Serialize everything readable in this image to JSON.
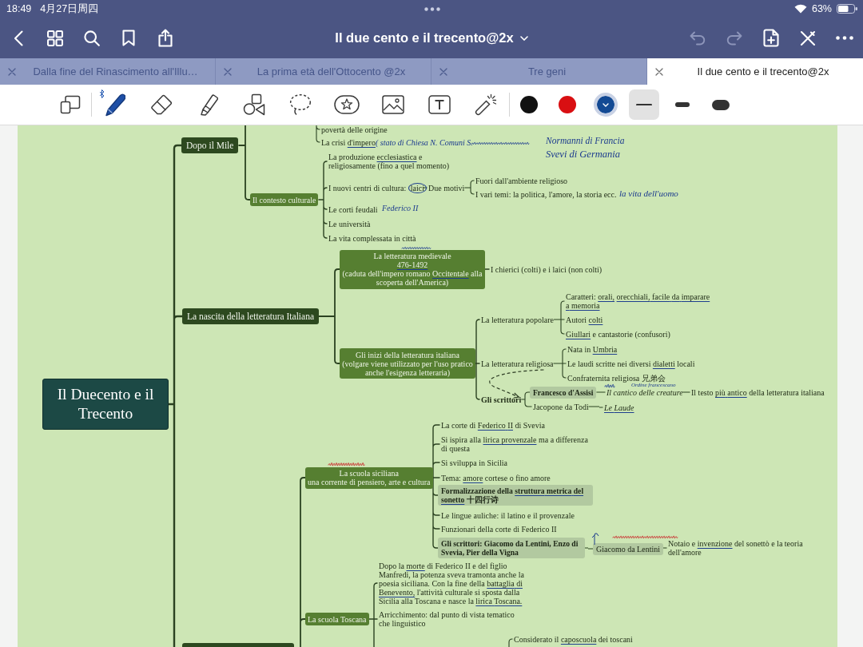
{
  "status_bar": {
    "time": "18:49",
    "date": "4月27日周四",
    "battery": "63%"
  },
  "nav_bar": {
    "title": "Il due cento e il trecento@2x",
    "undo": {
      "disabled": true
    },
    "redo": {
      "disabled": true
    }
  },
  "tabs": [
    {
      "label": "Dalla fine del Rinascimento all'Illu…",
      "selected": false
    },
    {
      "label": "La prima età dell'Ottocento @2x",
      "selected": false
    },
    {
      "label": "Tre geni",
      "selected": false
    },
    {
      "label": "Il due cento e il trecento@2x",
      "selected": true
    }
  ],
  "toolbar": {
    "tools": [
      {
        "kind": "reader",
        "selected": false
      },
      {
        "kind": "pen",
        "selected": true
      },
      {
        "kind": "eraser",
        "selected": false
      },
      {
        "kind": "highlighter",
        "selected": false
      },
      {
        "kind": "shapes",
        "selected": false
      },
      {
        "kind": "lasso",
        "selected": false
      },
      {
        "kind": "sticker",
        "selected": false
      },
      {
        "kind": "image",
        "selected": false
      },
      {
        "kind": "textbox",
        "selected": false
      },
      {
        "kind": "laser",
        "selected": false
      }
    ],
    "colors": [
      {
        "color": "#111111",
        "selected": false
      },
      {
        "color": "#d90f12",
        "selected": false
      },
      {
        "color": "#134a94",
        "selected": true
      }
    ],
    "widths": [
      {
        "kind": "thin",
        "selected": true
      },
      {
        "kind": "medium",
        "selected": false
      },
      {
        "kind": "thick",
        "selected": false
      }
    ]
  },
  "mind_map": {
    "root": {
      "text": "Il Duecento e il Trecento",
      "kind": "root",
      "children": [
        {
          "text": "Dopo il Mile",
          "kind": "main",
          "children": [
            {
              "kind": "offscreen",
              "children": [
                {
                  "text": "povertà delle origine",
                  "kind": "leaf"
                },
                {
                  "text": "La crisi d'impero",
                  "kind": "leaf"
                }
              ]
            },
            {
              "text": "Il contesto culturale",
              "kind": "sub",
              "children": [
                {
                  "text": "La produzione ecclesiastica e religiosamente (fino a quel momento)",
                  "kind": "leaf"
                },
                {
                  "text": "I nuovi centri di cultura: laici",
                  "kind": "leaf",
                  "children": [
                    {
                      "text": "Due motivi",
                      "kind": "leaf",
                      "children": [
                        {
                          "text": "Fuori dall'ambiente religioso",
                          "kind": "leaf"
                        },
                        {
                          "text": "I vari temi: la politica, l'amore, la storia ecc.",
                          "kind": "leaf"
                        }
                      ]
                    }
                  ]
                },
                {
                  "text": "Le corti feudali",
                  "kind": "leaf"
                },
                {
                  "text": "Le università",
                  "kind": "leaf"
                },
                {
                  "text": "La vita complessata in città",
                  "kind": "leaf"
                }
              ]
            }
          ]
        },
        {
          "text": "La nascita della letteratura Italiana",
          "kind": "main",
          "children": [
            {
              "text": "La letteratura medievale\n476-1492\n(caduta dell'impero romano Occitentale alla scoperta dell'America)",
              "kind": "sub",
              "children": [
                {
                  "text": "I chierici (colti) e i laici (non colti)",
                  "kind": "leaf"
                }
              ]
            },
            {
              "text": "Gli inizi della letteratura italiana\n(volgare viene utilizzato per l'uso pratico anche l'esigenza letteraria)",
              "kind": "sub",
              "children": [
                {
                  "text": "La letteratura popolare",
                  "kind": "leaf",
                  "children": [
                    {
                      "text": "Caratteri: orali, orecchiali, facile da imparare a memoria",
                      "kind": "leaf"
                    },
                    {
                      "text": "Autori colti",
                      "kind": "leaf"
                    },
                    {
                      "text": "Giullari e cantastorie (confusori)",
                      "kind": "leaf"
                    }
                  ]
                },
                {
                  "text": "La letteratura religiosa",
                  "kind": "leaf",
                  "children": [
                    {
                      "text": "Nata in Umbria",
                      "kind": "leaf"
                    },
                    {
                      "text": "Le laudi scritte nei diversi dialetti locali",
                      "kind": "leaf"
                    },
                    {
                      "text": "Confraternita religiosa 兄弟会",
                      "kind": "leaf"
                    }
                  ]
                },
                {
                  "text": "Gli scrittori",
                  "kind": "strong",
                  "link_from_previous": true,
                  "children": [
                    {
                      "text": "Francesco d'Assisi",
                      "kind": "marked",
                      "children": [
                        {
                          "text": "Il cantico delle creature",
                          "kind": "title",
                          "children": [
                            {
                              "text": "Il testo più antico della letteratura italiana",
                              "kind": "leaf"
                            }
                          ]
                        }
                      ]
                    },
                    {
                      "text": "Jacopone da Todi",
                      "kind": "leaf",
                      "children": [
                        {
                          "text": "Le Laude",
                          "kind": "title"
                        }
                      ]
                    }
                  ]
                }
              ]
            }
          ]
        },
        {
          "kind": "main",
          "children": [
            {
              "text": "La scuola siciliana\nuna corrente di pensiero, arte e cultura",
              "kind": "sub",
              "children": [
                {
                  "text": "La corte di Federico II di Svevia",
                  "kind": "leaf"
                },
                {
                  "text": "Si ispira alla lirica provenzale ma a differenza di questa",
                  "kind": "leaf"
                },
                {
                  "text": "Si sviluppa in Sicilia",
                  "kind": "leaf"
                },
                {
                  "text": "Tema: amore cortese o fino amore",
                  "kind": "leaf"
                },
                {
                  "text": "Formalizzazione della struttura metrica del sonetto 十四行诗",
                  "kind": "marked"
                },
                {
                  "text": "Le lingue auliche: il latino e il provenzale",
                  "kind": "leaf"
                },
                {
                  "text": "Funzionari della corte di Federico II",
                  "kind": "leaf"
                },
                {
                  "text": "Gli scrittori: Giacomo da Lentini, Enzo di Svevia, Pier della Vigna",
                  "kind": "marked",
                  "children": [
                    {
                      "text": "Giacomo da Lentini",
                      "kind": "tag",
                      "children": [
                        {
                          "text": "Notaio e invenzione del sonettò e la teoria dell'amore",
                          "kind": "leaf"
                        }
                      ]
                    }
                  ]
                }
              ]
            },
            {
              "text": "La scuola Toscana",
              "kind": "sub",
              "children": [
                {
                  "text": "Dopo la morte di Federico II e del figlio Manfredi, la potenza sveva tramonta anche la poesia siciliana. Con la fine della battaglia di Benevento, l'attività culturale si sposta dalla Sicilia alla Toscana e nasce la lirica Toscana.",
                  "kind": "leaf"
                },
                {
                  "text": "Arricchimento: dal punto di vista tematico che linguistico",
                  "kind": "leaf"
                },
                {
                  "kind": "offscreen",
                  "children": [
                    {
                      "text": "Considerato il caposcuola dei toscani",
                      "kind": "leaf"
                    }
                  ]
                }
              ]
            }
          ]
        }
      ]
    },
    "ink_notes": [
      {
        "text": "( stato di Chiesa N. Comuni S."
      },
      {
        "text": "Normanni di Francia"
      },
      {
        "text": "Svevi di Germania"
      },
      {
        "text": "Federico II"
      },
      {
        "text": "la vita dell'uomo"
      },
      {
        "text": "Ordine francescano"
      }
    ]
  }
}
